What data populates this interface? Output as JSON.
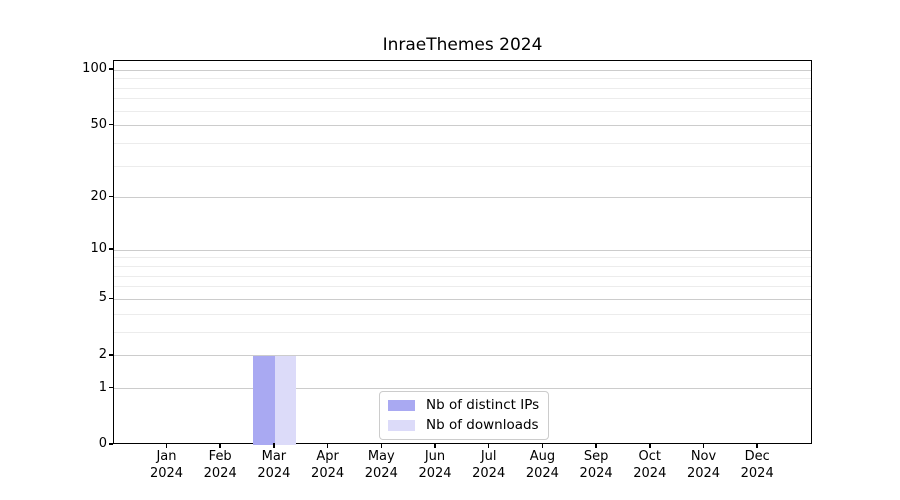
{
  "chart_data": {
    "type": "bar",
    "title": "InraeThemes 2024",
    "categories": [
      "Jan 2024",
      "Feb 2024",
      "Mar 2024",
      "Apr 2024",
      "May 2024",
      "Jun 2024",
      "Jul 2024",
      "Aug 2024",
      "Sep 2024",
      "Oct 2024",
      "Nov 2024",
      "Dec 2024"
    ],
    "series": [
      {
        "name": "Nb of distinct IPs",
        "color": "#a9a9f2",
        "values": [
          0,
          0,
          2,
          0,
          0,
          0,
          0,
          0,
          0,
          0,
          0,
          0
        ]
      },
      {
        "name": "Nb of downloads",
        "color": "#dcdbf9",
        "values": [
          0,
          0,
          2,
          0,
          0,
          0,
          0,
          0,
          0,
          0,
          0,
          0
        ]
      }
    ],
    "xlabel": "",
    "ylabel": "",
    "yscale": "log1p",
    "ylim": [
      0,
      112
    ],
    "y_major_ticks": [
      100,
      50,
      20,
      10,
      5,
      2,
      1,
      0
    ],
    "y_minor_ticks": [
      90,
      80,
      70,
      60,
      40,
      30,
      9,
      8,
      7,
      6,
      4,
      3
    ],
    "grid": true,
    "legend_position": "inside-bottom-center"
  },
  "colors": {
    "background": "#ffffff",
    "spine": "#000000",
    "major_grid": "#cccccc",
    "minor_grid": "#ececec",
    "legend_border": "#cccccc",
    "text": "#000000"
  }
}
